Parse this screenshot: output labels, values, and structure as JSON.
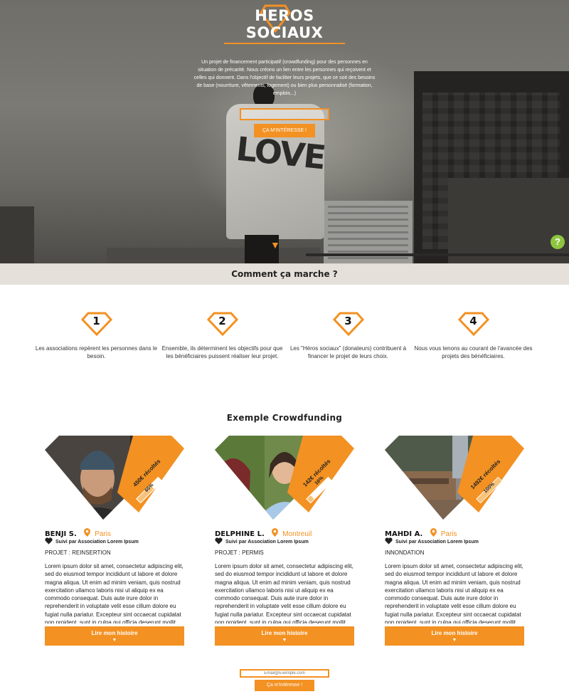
{
  "hero": {
    "title": "HEROS SOCIAUX",
    "description": "Un projet de financement participatif (crowdfunding) pour des personnes en situation de précarité. Nous créons un lien entre les personnes qui reçoivent et celles qui donnent. Dans l'objectif de faciliter leurs projets, que ce soit des besoins de base (nourriture, vêtements, logement) ou bien plus personnalisé (formation, emplois...)",
    "input_value": "",
    "cta_label": "ÇA M'INTÉRESSE !",
    "cloak_text": "LOVE",
    "help_label": "?"
  },
  "how": {
    "title": "Comment ça marche ?",
    "steps": [
      {
        "num": "1",
        "text": "Les associations repèrent les personnes dans le besoin."
      },
      {
        "num": "2",
        "text": "Ensemble, ils déterminent les objectifs pour que les bénéficiaires puissent réaliser leur projet."
      },
      {
        "num": "3",
        "text": "Les \"Héros sociaux\" (donateurs) contribuent à financer le projet de leurs choix."
      },
      {
        "num": "4",
        "text": "Nous vous tenons au courant de l'avancée des projets des bénéficiaires."
      }
    ]
  },
  "crowdfunding": {
    "title": "Exemple Crowdfunding",
    "cards": [
      {
        "name": "BENJI S.",
        "city": "Paris",
        "amount": "450€ récoltés",
        "percent_label": "65%",
        "percent": 65,
        "follow": "Suivi par Association Lorem Ipsum",
        "project": "PROJET : REINSERTION",
        "body": "Lorem ipsum dolor sit amet, consectetur adipiscing elit, sed do eiusmod tempor incididunt ut labore et dolore magna aliqua. Ut enim ad minim veniam, quis nostrud exercitation ullamco laboris nisi ut aliquip ex ea commodo consequat. Duis aute irure dolor in reprehenderit in voluptate velit esse cillum dolore eu fugiat nulla pariatur. Excepteur sint occaecat cupidatat non proident, sunt in culpa qui officia deserunt mollit anim id est laborum",
        "read_label": "Lire mon  histoire"
      },
      {
        "name": "DELPHINE L.",
        "city": "Montreuil",
        "amount": "142€ récoltés",
        "percent_label": "16%",
        "percent": 16,
        "follow": "Suivi par Association Lorem Ipsum",
        "project": "PROJET :  PERMIS",
        "body": "Lorem ipsum dolor sit amet, consectetur adipiscing elit, sed do eiusmod tempor incididunt ut labore et dolore magna aliqua. Ut enim ad minim veniam, quis nostrud exercitation ullamco laboris nisi ut aliquip ex ea commodo consequat. Duis aute irure dolor in reprehenderit in voluptate velit esse cillum dolore eu fugiat nulla pariatur. Excepteur sint occaecat cupidatat non proident, sunt in culpa qui officia deserunt mollit anim id est laborum",
        "read_label": "Lire mon  histoire"
      },
      {
        "name": "MAHDI A.",
        "city": "Paris",
        "amount": "1492€ récoltés",
        "percent_label": "100%",
        "percent": 100,
        "follow": "Suivi par Association Lorem Ipsum",
        "project": "INNONDATION",
        "body": "Lorem ipsum dolor sit amet, consectetur adipiscing elit, sed do eiusmod tempor incididunt ut labore et dolore magna aliqua. Ut enim ad minim veniam, quis nostrud exercitation ullamco laboris nisi ut aliquip ex ea commodo consequat. Duis aute irure dolor in reprehenderit in voluptate velit esse cillum dolore eu fugiat nulla pariatur. Excepteur sint occaecat cupidatat non proident, sunt in culpa qui officia deserunt mollit anim id est laborum",
        "read_label": "Lire mon  histoire"
      }
    ]
  },
  "footer": {
    "email_placeholder": "Email@Exemple.com",
    "cta_label": "Ça m'intéresse !"
  },
  "colors": {
    "accent": "#f39122",
    "help": "#8ec63f",
    "band": "#e5e0d9"
  }
}
